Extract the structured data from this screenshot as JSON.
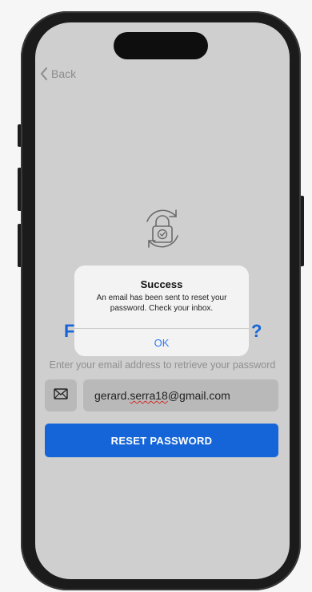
{
  "nav": {
    "back_label": "Back"
  },
  "page": {
    "headline_start": "F",
    "headline_end": "?",
    "instructions": "Enter your email address to retrieve your password"
  },
  "form": {
    "email_prefix": "gerard.",
    "email_misspelled": "serra18",
    "email_suffix": "@gmail.com",
    "reset_label": "RESET PASSWORD"
  },
  "dialog": {
    "title": "Success",
    "message": "An email has been sent to reset your password. Check your inbox.",
    "ok_label": "OK"
  },
  "colors": {
    "accent": "#1565d8",
    "dialog_button": "#2e7cf6",
    "screen_dim": "#cfcfcf"
  },
  "icons": [
    "chevron-left-icon",
    "lock-reset-icon",
    "envelope-icon"
  ]
}
